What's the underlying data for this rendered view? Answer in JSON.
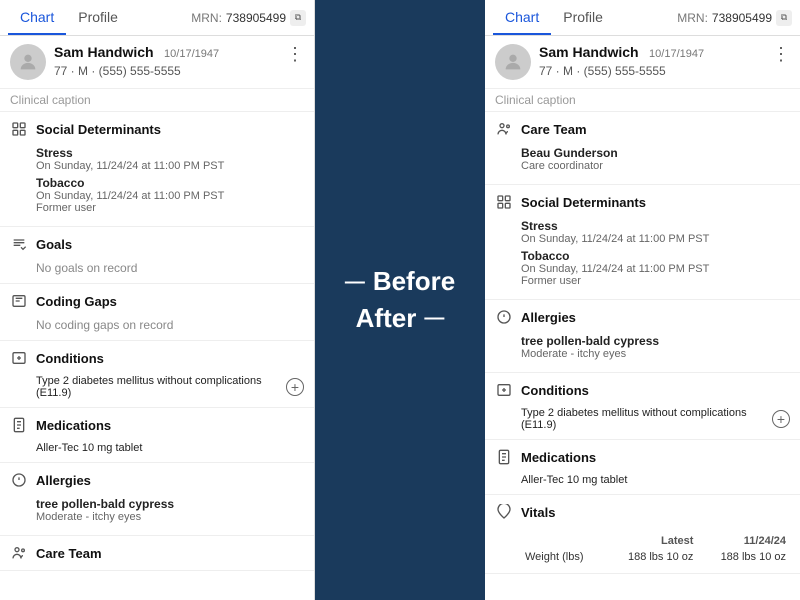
{
  "left": {
    "tabs": [
      {
        "label": "Chart",
        "active": true
      },
      {
        "label": "Profile",
        "active": false
      }
    ],
    "mrn": {
      "label": "MRN:",
      "value": "738905499"
    },
    "patient": {
      "name": "Sam Handwich",
      "dob": "10/17/1947",
      "details": "77 · M · (555) 555-5555"
    },
    "clinical_caption": "Clinical caption",
    "sections": [
      {
        "id": "social-determinants",
        "title": "Social Determinants",
        "items": [
          {
            "name": "Stress",
            "detail1": "On Sunday, 11/24/24 at 11:00 PM PST",
            "detail2": null
          },
          {
            "name": "Tobacco",
            "detail1": "On Sunday, 11/24/24 at 11:00 PM PST",
            "detail2": "Former user"
          }
        ]
      },
      {
        "id": "goals",
        "title": "Goals",
        "no_record": "No goals on record"
      },
      {
        "id": "coding-gaps",
        "title": "Coding Gaps",
        "no_record": "No coding gaps on record"
      },
      {
        "id": "conditions",
        "title": "Conditions",
        "items": [
          {
            "name": "Type 2 diabetes mellitus without complications (E11.9)",
            "detail1": null,
            "detail2": null
          }
        ],
        "has_add": true
      },
      {
        "id": "medications",
        "title": "Medications",
        "items": [
          {
            "name": "Aller-Tec 10 mg tablet",
            "detail1": null,
            "detail2": null
          }
        ]
      },
      {
        "id": "allergies",
        "title": "Allergies",
        "items": [
          {
            "name": "tree pollen-bald cypress",
            "detail1": "Moderate - itchy eyes",
            "detail2": null
          }
        ]
      },
      {
        "id": "care-team",
        "title": "Care Team",
        "items": []
      }
    ]
  },
  "right": {
    "tabs": [
      {
        "label": "Chart",
        "active": true
      },
      {
        "label": "Profile",
        "active": false
      }
    ],
    "mrn": {
      "label": "MRN:",
      "value": "738905499"
    },
    "patient": {
      "name": "Sam Handwich",
      "dob": "10/17/1947",
      "details": "77 · M · (555) 555-5555"
    },
    "clinical_caption": "Clinical caption",
    "sections": [
      {
        "id": "care-team",
        "title": "Care Team",
        "items": [
          {
            "name": "Beau Gunderson",
            "detail1": "Care coordinator",
            "detail2": null
          }
        ]
      },
      {
        "id": "social-determinants",
        "title": "Social Determinants",
        "items": [
          {
            "name": "Stress",
            "detail1": "On Sunday, 11/24/24 at 11:00 PM PST",
            "detail2": null
          },
          {
            "name": "Tobacco",
            "detail1": "On Sunday, 11/24/24 at 11:00 PM PST",
            "detail2": "Former user"
          }
        ]
      },
      {
        "id": "allergies",
        "title": "Allergies",
        "items": [
          {
            "name": "tree pollen-bald cypress",
            "detail1": "Moderate - itchy eyes",
            "detail2": null
          }
        ]
      },
      {
        "id": "conditions",
        "title": "Conditions",
        "items": [
          {
            "name": "Type 2 diabetes mellitus without complications (E11.9)",
            "detail1": null,
            "detail2": null
          }
        ],
        "has_add": true
      },
      {
        "id": "medications",
        "title": "Medications",
        "items": [
          {
            "name": "Aller-Tec 10 mg tablet",
            "detail1": null,
            "detail2": null
          }
        ]
      },
      {
        "id": "vitals",
        "title": "Vitals",
        "vitals": {
          "headers": [
            "",
            "Latest",
            "11/24/24"
          ],
          "rows": [
            [
              "Weight (lbs)",
              "188 lbs 10 oz",
              "188 lbs 10 oz"
            ]
          ]
        }
      }
    ]
  },
  "divider": {
    "before_label": "Before",
    "after_label": "After"
  }
}
